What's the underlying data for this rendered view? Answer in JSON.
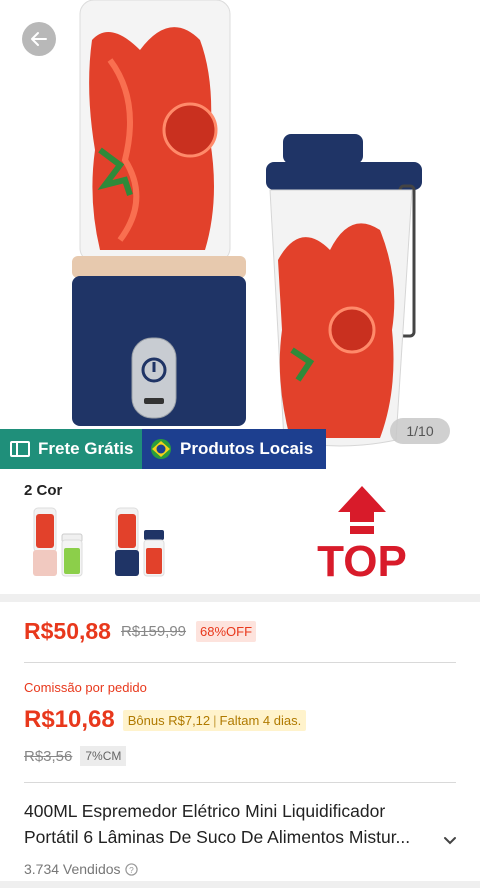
{
  "gallery": {
    "counter": "1/10"
  },
  "badges": {
    "frete": "Frete Grátis",
    "locais": "Produtos Locais"
  },
  "variants": {
    "title": "2 Cor",
    "top_logo_text": "TOP"
  },
  "price": {
    "current": "R$50,88",
    "original": "R$159,99",
    "discount": "68%OFF"
  },
  "commission": {
    "label": "Comissão por pedido",
    "value": "R$10,68",
    "bonus": "Bônus R$7,12",
    "remaining": "Faltam 4 dias.",
    "old_value": "R$3,56",
    "rate": "7%CM"
  },
  "product": {
    "title_line1": "400ML Espremedor Elétrico Mini Liquidificador",
    "title_line2": "Portátil 6 Lâminas De Suco De Alimentos Mistur...",
    "sold": "3.734 Vendidos"
  },
  "colors": {
    "accent_red": "#e8381c",
    "frete_green": "#1f8f7a",
    "locais_blue": "#1d3f8f",
    "blender_navy": "#1f3466"
  }
}
